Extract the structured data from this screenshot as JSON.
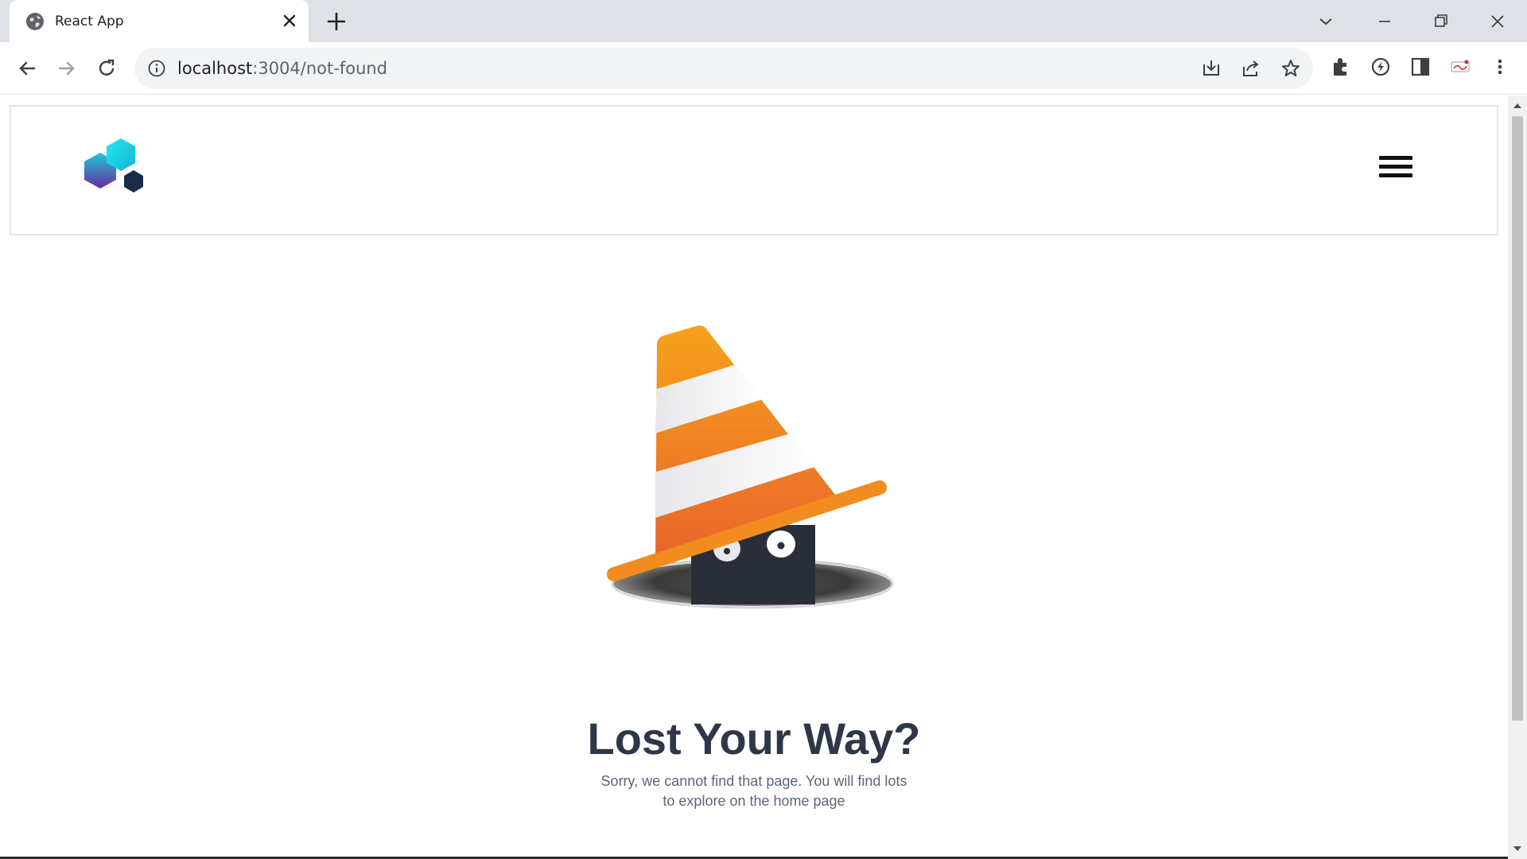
{
  "browser": {
    "tab_title": "React App",
    "url_host": "localhost",
    "url_rest": ":3004/not-found",
    "icons": {
      "favicon": "globe-icon",
      "tab_close": "close-icon",
      "new_tab": "plus-icon",
      "tab_search": "chevron-down-icon",
      "minimize": "minimize-icon",
      "restore": "restore-icon",
      "close_window": "close-icon",
      "back": "back-arrow-icon",
      "forward": "forward-arrow-icon",
      "reload": "reload-icon",
      "site_info": "info-icon",
      "install": "install-icon",
      "share": "share-icon",
      "bookmark": "star-icon",
      "extensions": "puzzle-icon",
      "performance": "speed-icon",
      "side_panel": "side-panel-icon",
      "profile": "profile-icon",
      "menu": "kebab-menu-icon"
    }
  },
  "page": {
    "title": "Lost Your Way?",
    "message": "Sorry, we cannot find that page. You will find lots to explore on the home page",
    "colors": {
      "title": "#2d3748",
      "message": "#5a6679",
      "cone_orange": "#f7931e",
      "hole_dark": "#2a2e38"
    }
  }
}
